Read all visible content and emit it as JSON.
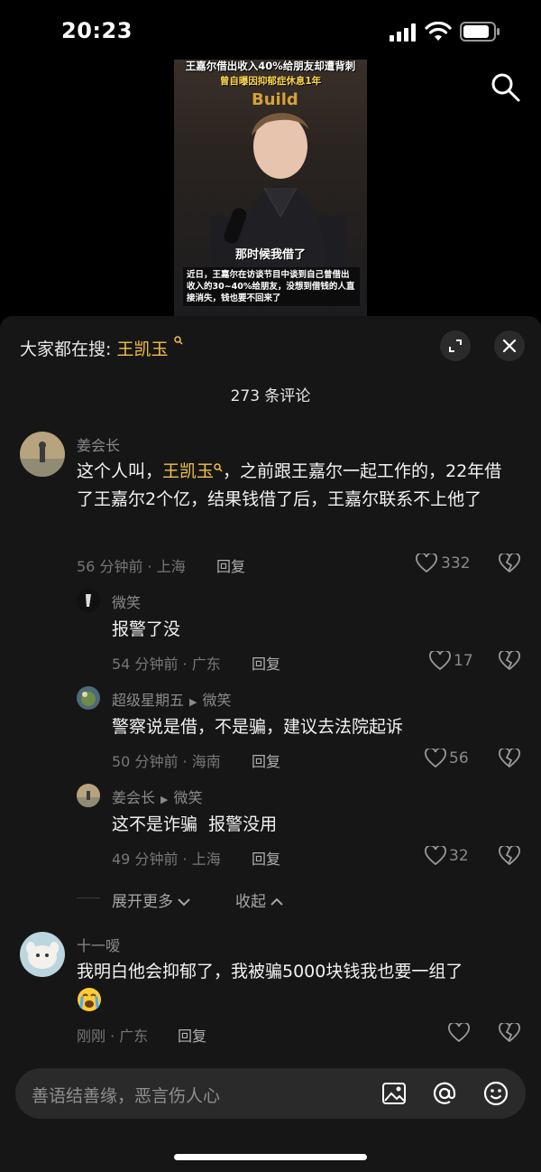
{
  "status": {
    "time": "20:23"
  },
  "video": {
    "title": "王嘉尔借出收入40%给朋友却遭背刺",
    "subtitle": "曾自曝因抑郁症休息1年",
    "brand_text": "Build",
    "caption": "那时候我借了",
    "body": "近日，王嘉尔在访谈节目中谈到自己曾借出收入的30~40%给朋友，没想到借钱的人直接消失，钱也要不回来了"
  },
  "sheet": {
    "hot_prefix": "大家都在搜:",
    "hot_keyword": "王凯玉",
    "count_label": "273 条评论"
  },
  "comments": [
    {
      "user": "姜会长",
      "text_a": "这个人叫，",
      "text_kw": "王凯玉",
      "text_b": "，之前跟王嘉尔一起工作的，22年借了王嘉尔2个亿，结果钱借了后，王嘉尔联系不上他了",
      "meta": "56 分钟前 · 上海",
      "reply": "回复",
      "likes": "332"
    },
    {
      "user": "微笑",
      "text": "报警了没",
      "meta": "54 分钟前 · 广东",
      "reply": "回复",
      "likes": "17"
    },
    {
      "user": "超级星期五",
      "reply_to": "微笑",
      "text": "警察说是借，不是骗，建议去法院起诉",
      "meta": "50 分钟前 · 海南",
      "reply": "回复",
      "likes": "56"
    },
    {
      "user": "姜会长",
      "reply_to": "微笑",
      "text": "这不是诈骗  报警没用",
      "meta": "49 分钟前 · 上海",
      "reply": "回复",
      "likes": "32"
    },
    {
      "user": "十一嗳",
      "text": "我明白他会抑郁了，我被骗5000块钱我也要一组了",
      "meta": "刚刚 · 广东",
      "reply": "回复"
    }
  ],
  "thread": {
    "more": "展开更多",
    "fold": "收起"
  },
  "input": {
    "placeholder": "善语结善缘，恶言伤人心"
  },
  "colors": {
    "accent": "#f0c14b",
    "sheet_bg": "#161616",
    "input_bg": "#2a2a2a"
  },
  "icons": [
    "search-icon",
    "expand-icon",
    "close-icon",
    "heart-icon",
    "dislike-icon",
    "image-icon",
    "at-icon",
    "emoji-icon"
  ]
}
